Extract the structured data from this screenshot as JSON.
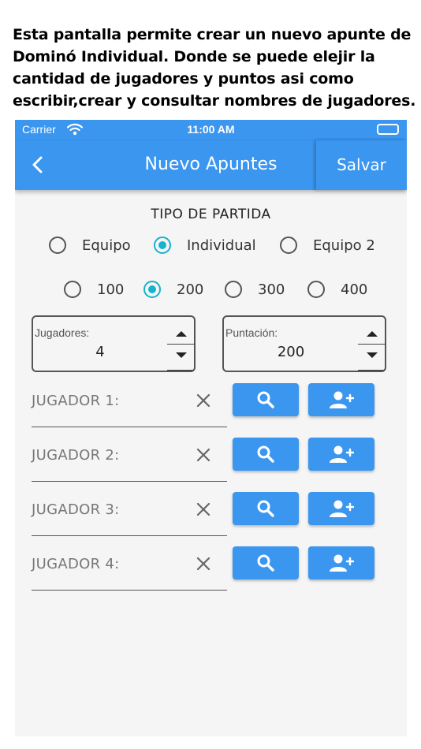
{
  "caption": "Esta pantalla permite crear un nuevo apunte de Dominó Individual. Donde se puede elejir la cantidad de jugadores y puntos asi como escribir,crear y consultar nombres de jugadores.",
  "status_bar": {
    "carrier": "Carrier",
    "time": "11:00 AM"
  },
  "app_bar": {
    "title": "Nuevo Apuntes",
    "save_label": "Salvar",
    "back_icon": "chevron-left-icon"
  },
  "game_type": {
    "title": "TIPO DE PARTIDA",
    "options": [
      {
        "label": "Equipo",
        "selected": false
      },
      {
        "label": "Individual",
        "selected": true
      },
      {
        "label": "Equipo 2",
        "selected": false
      }
    ]
  },
  "points": {
    "options": [
      {
        "label": "100",
        "selected": false
      },
      {
        "label": "200",
        "selected": true
      },
      {
        "label": "300",
        "selected": false
      },
      {
        "label": "400",
        "selected": false
      }
    ]
  },
  "players_stepper": {
    "label": "Jugadores:",
    "value": "4"
  },
  "score_stepper": {
    "label": "Puntación:",
    "value": "200"
  },
  "players": [
    {
      "label": "JUGADOR 1:"
    },
    {
      "label": "JUGADOR 2:"
    },
    {
      "label": "JUGADOR 3:"
    },
    {
      "label": "JUGADOR 4:"
    }
  ],
  "colors": {
    "primary": "#3a96ef",
    "radio_selected": "#16b3cc",
    "background": "#f5f5f5"
  },
  "icons": {
    "clear": "close-icon",
    "search": "search-icon",
    "add_user": "add-user-icon"
  }
}
